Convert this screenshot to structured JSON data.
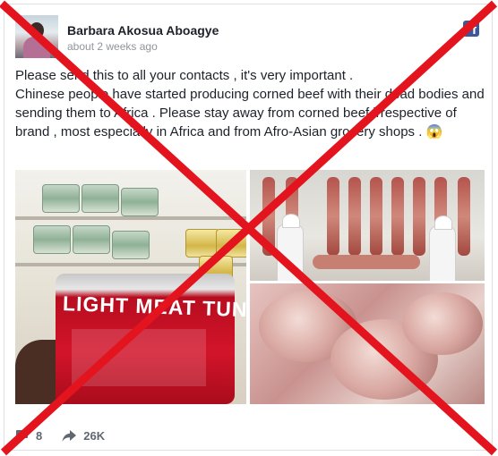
{
  "post": {
    "author": "Barbara Akosua Aboagye",
    "timestamp": "about 2 weeks ago",
    "text_lines": [
      "Please send this to all your contacts , it's very important .",
      "Chinese people have started producing corned beef with their dead bodies and sending them to Africa . Please stay away from corned beef irrespective of brand , most especially in Africa and from Afro-Asian grocery shops . 😱"
    ],
    "images": [
      {
        "icon": "canned-tuna-photo",
        "label_text": "LIGHT MEAT TUNA"
      },
      {
        "icon": "meat-factory-photo"
      },
      {
        "icon": "raw-meat-photo"
      }
    ],
    "overlay": {
      "icon": "red-x-mark",
      "color": "#e3141e"
    },
    "stats": {
      "comments": "8",
      "shares": "26K"
    }
  },
  "colors": {
    "text": "#1d2129",
    "muted": "#90949c",
    "facebook": "#3b5998",
    "stat": "#606770"
  }
}
